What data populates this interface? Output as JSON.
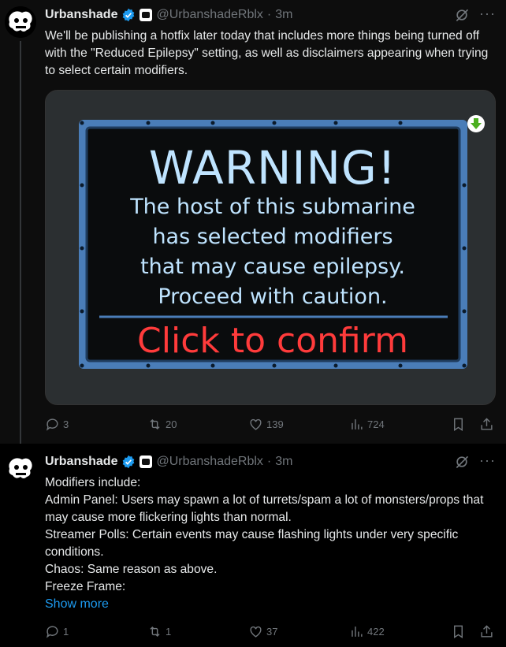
{
  "tweets": [
    {
      "author": {
        "name": "Urbanshade",
        "handle": "@UrbanshadeRblx",
        "separator": "·",
        "time": "3m"
      },
      "text": "We'll be publishing a hotfix later today that includes more things being turned off with the \"Reduced Epilepsy\" setting, as well as disclaimers appearing when trying to select certain modifiers.",
      "media": {
        "lines": [
          "WARNING!",
          "The host of this submarine",
          "has selected modifiers",
          "that may cause epilepsy.",
          "Proceed with caution.",
          "Click to confirm"
        ],
        "download_icon": "down-arrow-icon"
      },
      "stats": {
        "replies": "3",
        "reposts": "20",
        "likes": "139",
        "views": "724"
      }
    },
    {
      "author": {
        "name": "Urbanshade",
        "handle": "@UrbanshadeRblx",
        "separator": "·",
        "time": "3m"
      },
      "text": "Modifiers include:\nAdmin Panel: Users may spawn a lot of turrets/spam a lot of monsters/props that may cause more flickering lights than normal.\nStreamer Polls: Certain events may cause flashing lights under very specific conditions.\nChaos: Same reason as above.\nFreeze Frame:",
      "show_more": "Show more",
      "stats": {
        "replies": "1",
        "reposts": "1",
        "likes": "37",
        "views": "422"
      }
    }
  ],
  "colors": {
    "accent": "#1d9bf0",
    "verified": "#1d9bf0",
    "muted": "#71767b",
    "warning_red": "#ff3b3b",
    "warning_blue": "#bfe4ff"
  }
}
